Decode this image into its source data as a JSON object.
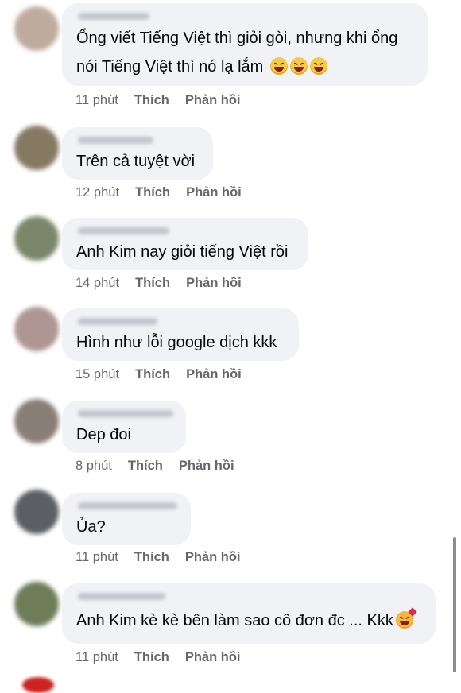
{
  "actions": {
    "like": "Thích",
    "reply": "Phản hồi"
  },
  "comments": [
    {
      "text_parts": [
        "Ổng viết Tiếng Việt thì giỏi gòi,  nhưng khi ổng",
        "nói Tiếng Việt thì nó lạ lắm"
      ],
      "time": "11 phút",
      "emoji": [
        "grinning-squinting-face-icon",
        "grinning-squinting-face-icon",
        "grinning-squinting-face-icon"
      ],
      "avatar_color": "#b8a394"
    },
    {
      "text_parts": [
        "Trên cả tuyệt vời"
      ],
      "time": "12 phút",
      "avatar_color": "#7a6b52"
    },
    {
      "text_parts": [
        "Anh Kim nay giỏi tiếng Việt rồi"
      ],
      "time": "14 phút",
      "avatar_color": "#6d7b5a"
    },
    {
      "text_parts": [
        "Hình như lỗi google dịch kkk"
      ],
      "time": "15 phút",
      "avatar_color": "#a58b88"
    },
    {
      "text_parts": [
        "Dep đoi"
      ],
      "time": "8 phút",
      "avatar_color": "#7d6f6a"
    },
    {
      "text_parts": [
        "Ủa?"
      ],
      "time": "11 phút",
      "avatar_color": "#4a4d52"
    },
    {
      "text_parts": [
        "Anh Kim kè kè bên làm sao cô đơn đc ... Kkk"
      ],
      "time": "11 phút",
      "emoji": [
        "smiling-face-with-hearts-icon"
      ],
      "avatar_color": "#5f6e47"
    }
  ]
}
